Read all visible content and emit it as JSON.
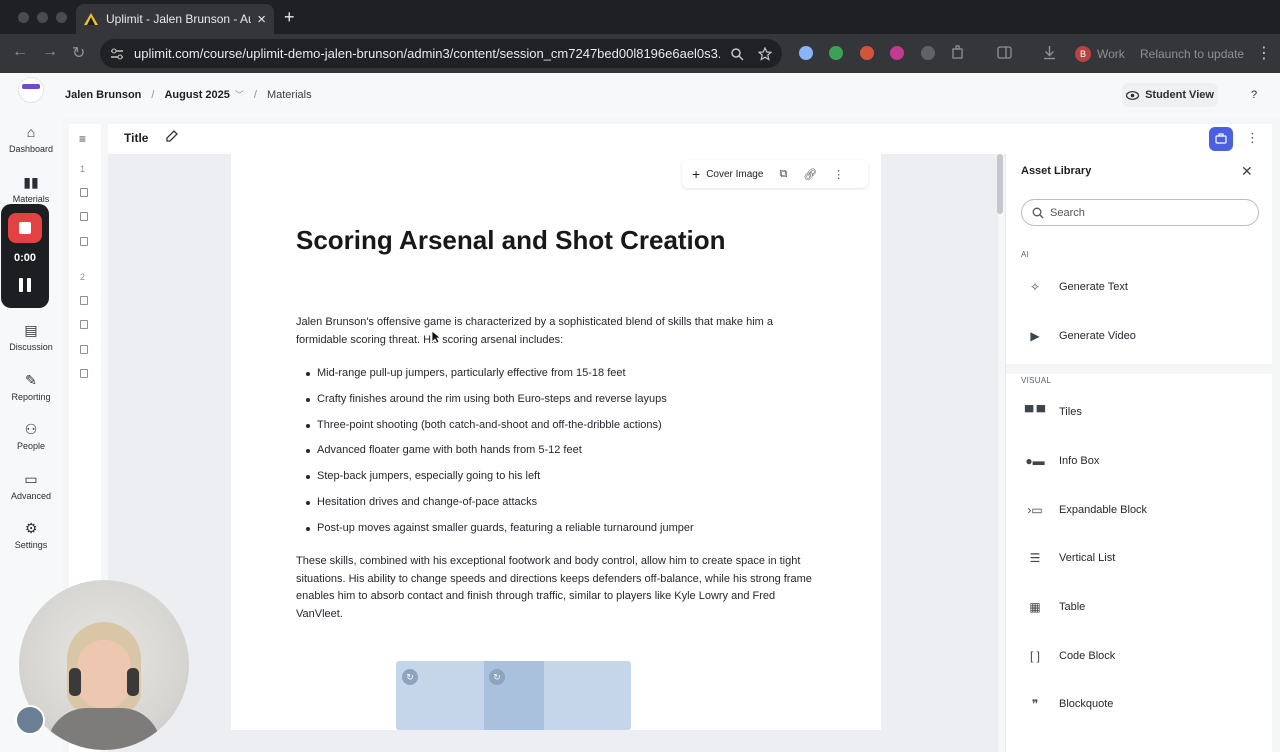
{
  "browser": {
    "tab_title": "Uplimit - Jalen Brunson - Aug",
    "tab_close": "×",
    "new_tab": "+",
    "url": "uplimit.com/course/uplimit-demo-jalen-brunson/admin3/content/session_cm7247bed00l8196e6ael0s3...",
    "profile_label": "Work",
    "profile_initial": "B",
    "relaunch_label": "Relaunch to update",
    "back_icon": "←",
    "forward_icon": "→",
    "reload_icon": "↻",
    "menu_icon": "⋮"
  },
  "header": {
    "breadcrumb": {
      "course": "Jalen Brunson",
      "session": "August 2025",
      "page": "Materials"
    },
    "student_view": "Student View",
    "help": "?"
  },
  "leftnav": {
    "items": [
      {
        "label": "Dashboard",
        "icon": "rocket-icon"
      },
      {
        "label": "Materials",
        "icon": "book-icon"
      },
      {
        "label": "Discussion",
        "icon": "chat-icon"
      },
      {
        "label": "Reporting",
        "icon": "pencil-icon"
      },
      {
        "label": "People",
        "icon": "people-icon"
      },
      {
        "label": "Advanced",
        "icon": "advanced-icon"
      },
      {
        "label": "Settings",
        "icon": "gear-icon"
      }
    ]
  },
  "recorder": {
    "time": "0:00"
  },
  "outline": {
    "section_1": "1",
    "section_2": "2"
  },
  "titlebar": {
    "title": "Title"
  },
  "page": {
    "tools": {
      "cover_image": "Cover Image"
    },
    "heading": "Scoring Arsenal and Shot Creation",
    "intro": "Jalen Brunson's offensive game is characterized by a sophisticated blend of skills that make him a formidable scoring threat. His scoring arsenal includes:",
    "bullets": [
      "Mid-range pull-up jumpers, particularly effective from 15-18 feet",
      "Crafty finishes around the rim using both Euro-steps and reverse layups",
      "Three-point shooting (both catch-and-shoot and off-the-dribble actions)",
      "Advanced floater game with both hands from 5-12 feet",
      "Step-back jumpers, especially going to his left",
      "Hesitation drives and change-of-pace attacks",
      "Post-up moves against smaller guards, featuring a reliable turnaround jumper"
    ],
    "closing": "These skills, combined with his exceptional footwork and body control, allow him to create space in tight situations. His ability to change speeds and directions keeps defenders off-balance, while his strong frame enables him to absorb contact and finish through traffic, similar to players like Kyle Lowry and Fred VanVleet."
  },
  "assets": {
    "title": "Asset Library",
    "search_placeholder": "Search",
    "ai_label": "AI",
    "ai_items": [
      {
        "label": "Generate Text",
        "icon": "sparkle-icon"
      },
      {
        "label": "Generate Video",
        "icon": "video-icon"
      }
    ],
    "visual_label": "VISUAL",
    "visual_items": [
      {
        "label": "Tiles",
        "icon": "tiles-icon"
      },
      {
        "label": "Info Box",
        "icon": "info-box-icon"
      },
      {
        "label": "Expandable Block",
        "icon": "expandable-icon"
      },
      {
        "label": "Vertical List",
        "icon": "vertical-list-icon"
      },
      {
        "label": "Table",
        "icon": "table-icon"
      },
      {
        "label": "Code Block",
        "icon": "code-block-icon"
      },
      {
        "label": "Blockquote",
        "icon": "quote-icon"
      }
    ]
  },
  "colors": {
    "accent": "#4c5fe0",
    "recorder_red": "#e34242",
    "brand_purple": "#6d4ad8"
  }
}
